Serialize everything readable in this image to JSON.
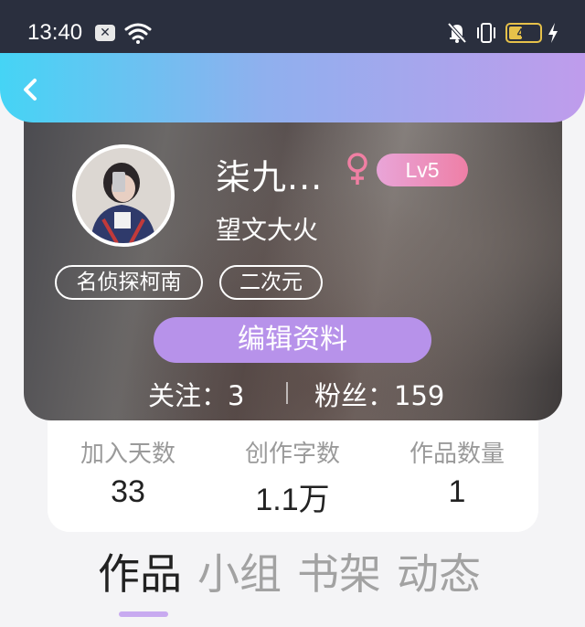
{
  "status_bar": {
    "time": "13:40",
    "notification_icon": "x-box-icon",
    "battery_level": "43",
    "battery_fraction": 0.43
  },
  "header": {
    "back_icon": "chevron-left-icon"
  },
  "profile": {
    "nickname": "柒九...",
    "gender_icon": "female-icon",
    "level": "Lv5",
    "signature": "望文大火",
    "tags": [
      "名侦探柯南",
      "二次元"
    ],
    "edit_button": "编辑资料",
    "following": "关注：3",
    "followers": "粉丝：159"
  },
  "stats": [
    {
      "label": "加入天数",
      "value": "33"
    },
    {
      "label": "创作字数",
      "value": "1.1万"
    },
    {
      "label": "作品数量",
      "value": "1"
    }
  ],
  "tabs": [
    {
      "label": "作品",
      "active": true
    },
    {
      "label": "小组",
      "active": false
    },
    {
      "label": "书架",
      "active": false
    },
    {
      "label": "动态",
      "active": false
    }
  ],
  "colors": {
    "header_gradient_start": "#45d4f5",
    "header_gradient_end": "#bf9cec",
    "edit_button": "#b792ea",
    "level_badge": "#ee7fa6",
    "gender_icon": "#f07fa3",
    "tab_indicator": "#c8aaf0"
  }
}
